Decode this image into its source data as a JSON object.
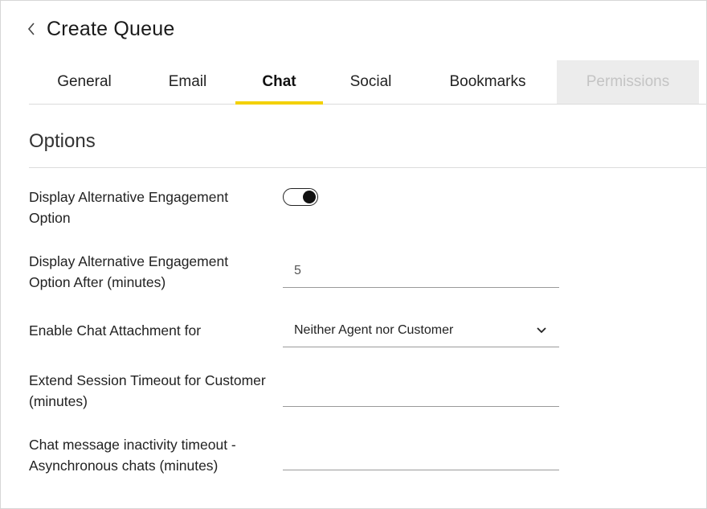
{
  "header": {
    "title": "Create Queue"
  },
  "tabs": [
    {
      "label": "General"
    },
    {
      "label": "Email"
    },
    {
      "label": "Chat"
    },
    {
      "label": "Social"
    },
    {
      "label": "Bookmarks"
    },
    {
      "label": "Permissions"
    }
  ],
  "active_tab": "Chat",
  "section": {
    "title": "Options"
  },
  "fields": {
    "alt_engagement": {
      "label": "Display Alternative Engagement Option",
      "value": true
    },
    "alt_engagement_after": {
      "label": "Display Alternative Engagement Option After (minutes)",
      "value": "5"
    },
    "chat_attachment": {
      "label": "Enable Chat Attachment for",
      "value": "Neither Agent nor Customer"
    },
    "extend_session": {
      "label": "Extend Session Timeout for Customer (minutes)",
      "value": ""
    },
    "inactivity_timeout": {
      "label": "Chat message inactivity timeout - Asynchronous chats (minutes)",
      "value": ""
    }
  },
  "colors": {
    "accent": "#f3d100",
    "disabled_tab_bg": "#ececec"
  },
  "icons": {
    "back": "chevron-left-icon",
    "dropdown": "chevron-down-icon"
  }
}
